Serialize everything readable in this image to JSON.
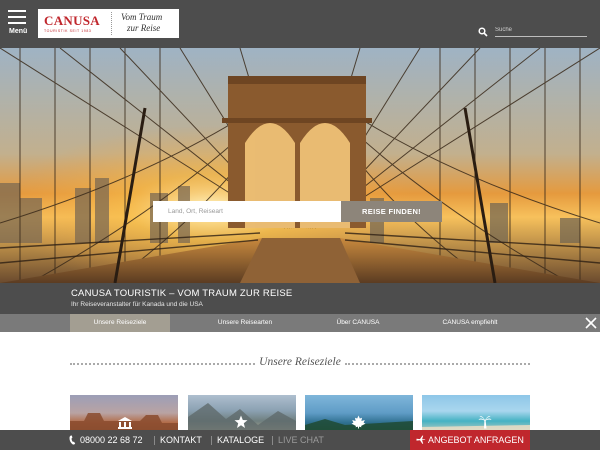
{
  "header": {
    "menu_label": "Menü",
    "logo": {
      "brand": "CANUSA",
      "subline": "TOURISTIK SEIT 1983",
      "tagline_line1": "Vom Traum",
      "tagline_line2": "zur Reise"
    },
    "search": {
      "placeholder": "Suche"
    }
  },
  "hero": {
    "search": {
      "placeholder": "Land, Ort, Reiseart",
      "button": "REISE FINDEN!"
    },
    "title": "CANUSA TOURISTIK – VOM TRAUM ZUR REISE",
    "subtitle": "Ihr Reiseveranstalter für Kanada und die USA"
  },
  "tabs": [
    {
      "label": "Unsere Reiseziele",
      "active": true
    },
    {
      "label": "Unsere Reisearten",
      "active": false
    },
    {
      "label": "Über CANUSA",
      "active": false
    },
    {
      "label": "CANUSA empfiehlt",
      "active": false
    }
  ],
  "section": {
    "title": "Unsere Reiseziele"
  },
  "cards": [
    {
      "icon": "landmark-icon"
    },
    {
      "icon": "star-icon"
    },
    {
      "icon": "maple-leaf-icon"
    },
    {
      "icon": "palm-tree-icon"
    }
  ],
  "bottom_bar": {
    "phone": "08000 22 68 72",
    "contact": "KONTAKT",
    "catalogs": "KATALOGE",
    "live_chat": "LIVE CHAT",
    "offer_button": "ANGEBOT ANFRAGEN"
  },
  "colors": {
    "header_bg": "#4d4d4d",
    "brand_red": "#c0272d",
    "tab_active": "#a39e92",
    "hero_button": "#8d857a"
  }
}
